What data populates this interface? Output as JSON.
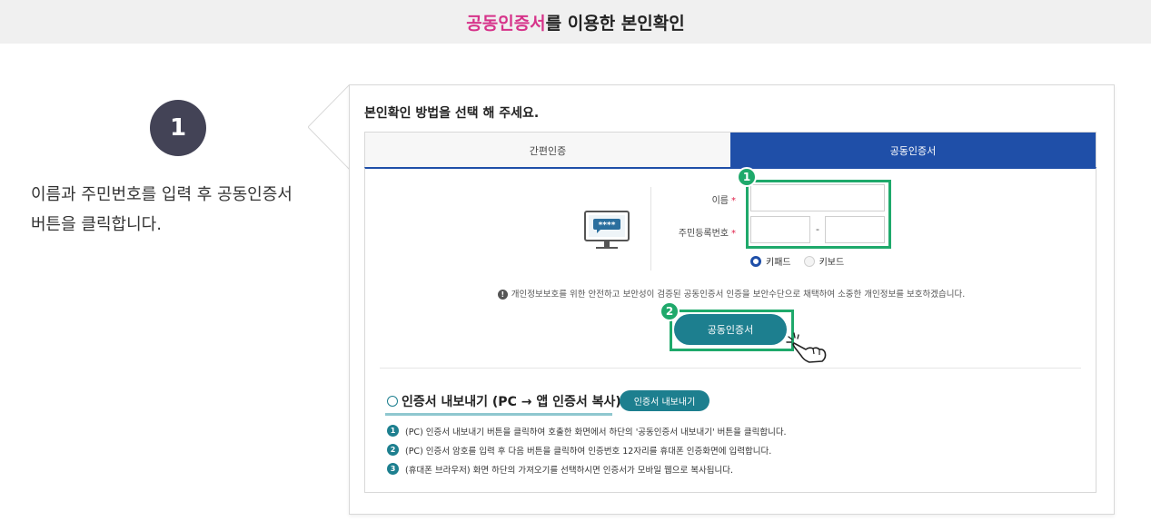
{
  "banner": {
    "accent": "공동인증서",
    "rest": "를 이용한 본인확인"
  },
  "step": {
    "number": "1",
    "desc_line1": "이름과 주민번호를 입력 후 공동인증서",
    "desc_line2": "버튼을 클릭합니다."
  },
  "panel": {
    "title": "본인확인 방법을 선택 해 주세요.",
    "tabs": [
      {
        "label": "간편인증"
      },
      {
        "label": "공동인증서"
      }
    ],
    "form": {
      "name_label": "이름",
      "rrn_label": "주민등록번호",
      "required_mark": "*",
      "rrn_dash": "-",
      "name_value": "",
      "rrn_front_value": "",
      "rrn_back_value": ""
    },
    "radio": {
      "keypad": "키패드",
      "keyboard": "키보드"
    },
    "badges": {
      "one": "1",
      "two": "2"
    },
    "notice_icon": "!",
    "notice": "개인정보보호를 위한 안전하고 보안성이 검증된 공동인증서 인증을 보안수단으로 채택하여 소중한 개인정보를 보호하겠습니다.",
    "cert_button": "공동인증서",
    "export": {
      "title": "인증서 내보내기 (PC → 앱 인증서 복사)",
      "button": "인증서 내보내기",
      "steps": [
        {
          "n": "1",
          "text": "(PC) 인증서 내보내기 버튼을 클릭하여 호출한 화면에서 하단의 '공동인증서 내보내기' 버튼을 클릭합니다."
        },
        {
          "n": "2",
          "text": "(PC) 인증서 암호를 입력 후 다음 버튼을 클릭하여 인증번호 12자리를 휴대폰 인증화면에 입력합니다."
        },
        {
          "n": "3",
          "text": "(휴대폰 브라우저) 화면 하단의 가져오기를 선택하시면 인증서가 모바일 웹으로 복사됩니다."
        }
      ]
    }
  },
  "colors": {
    "accent": "#d6338a",
    "tab_active": "#1f4fa8",
    "teal": "#1d7f8f",
    "highlight": "#1fa96b",
    "step_circle": "#434356"
  },
  "icons": {
    "monitor": "monitor-password-icon",
    "hand": "hand-pointer-icon"
  }
}
